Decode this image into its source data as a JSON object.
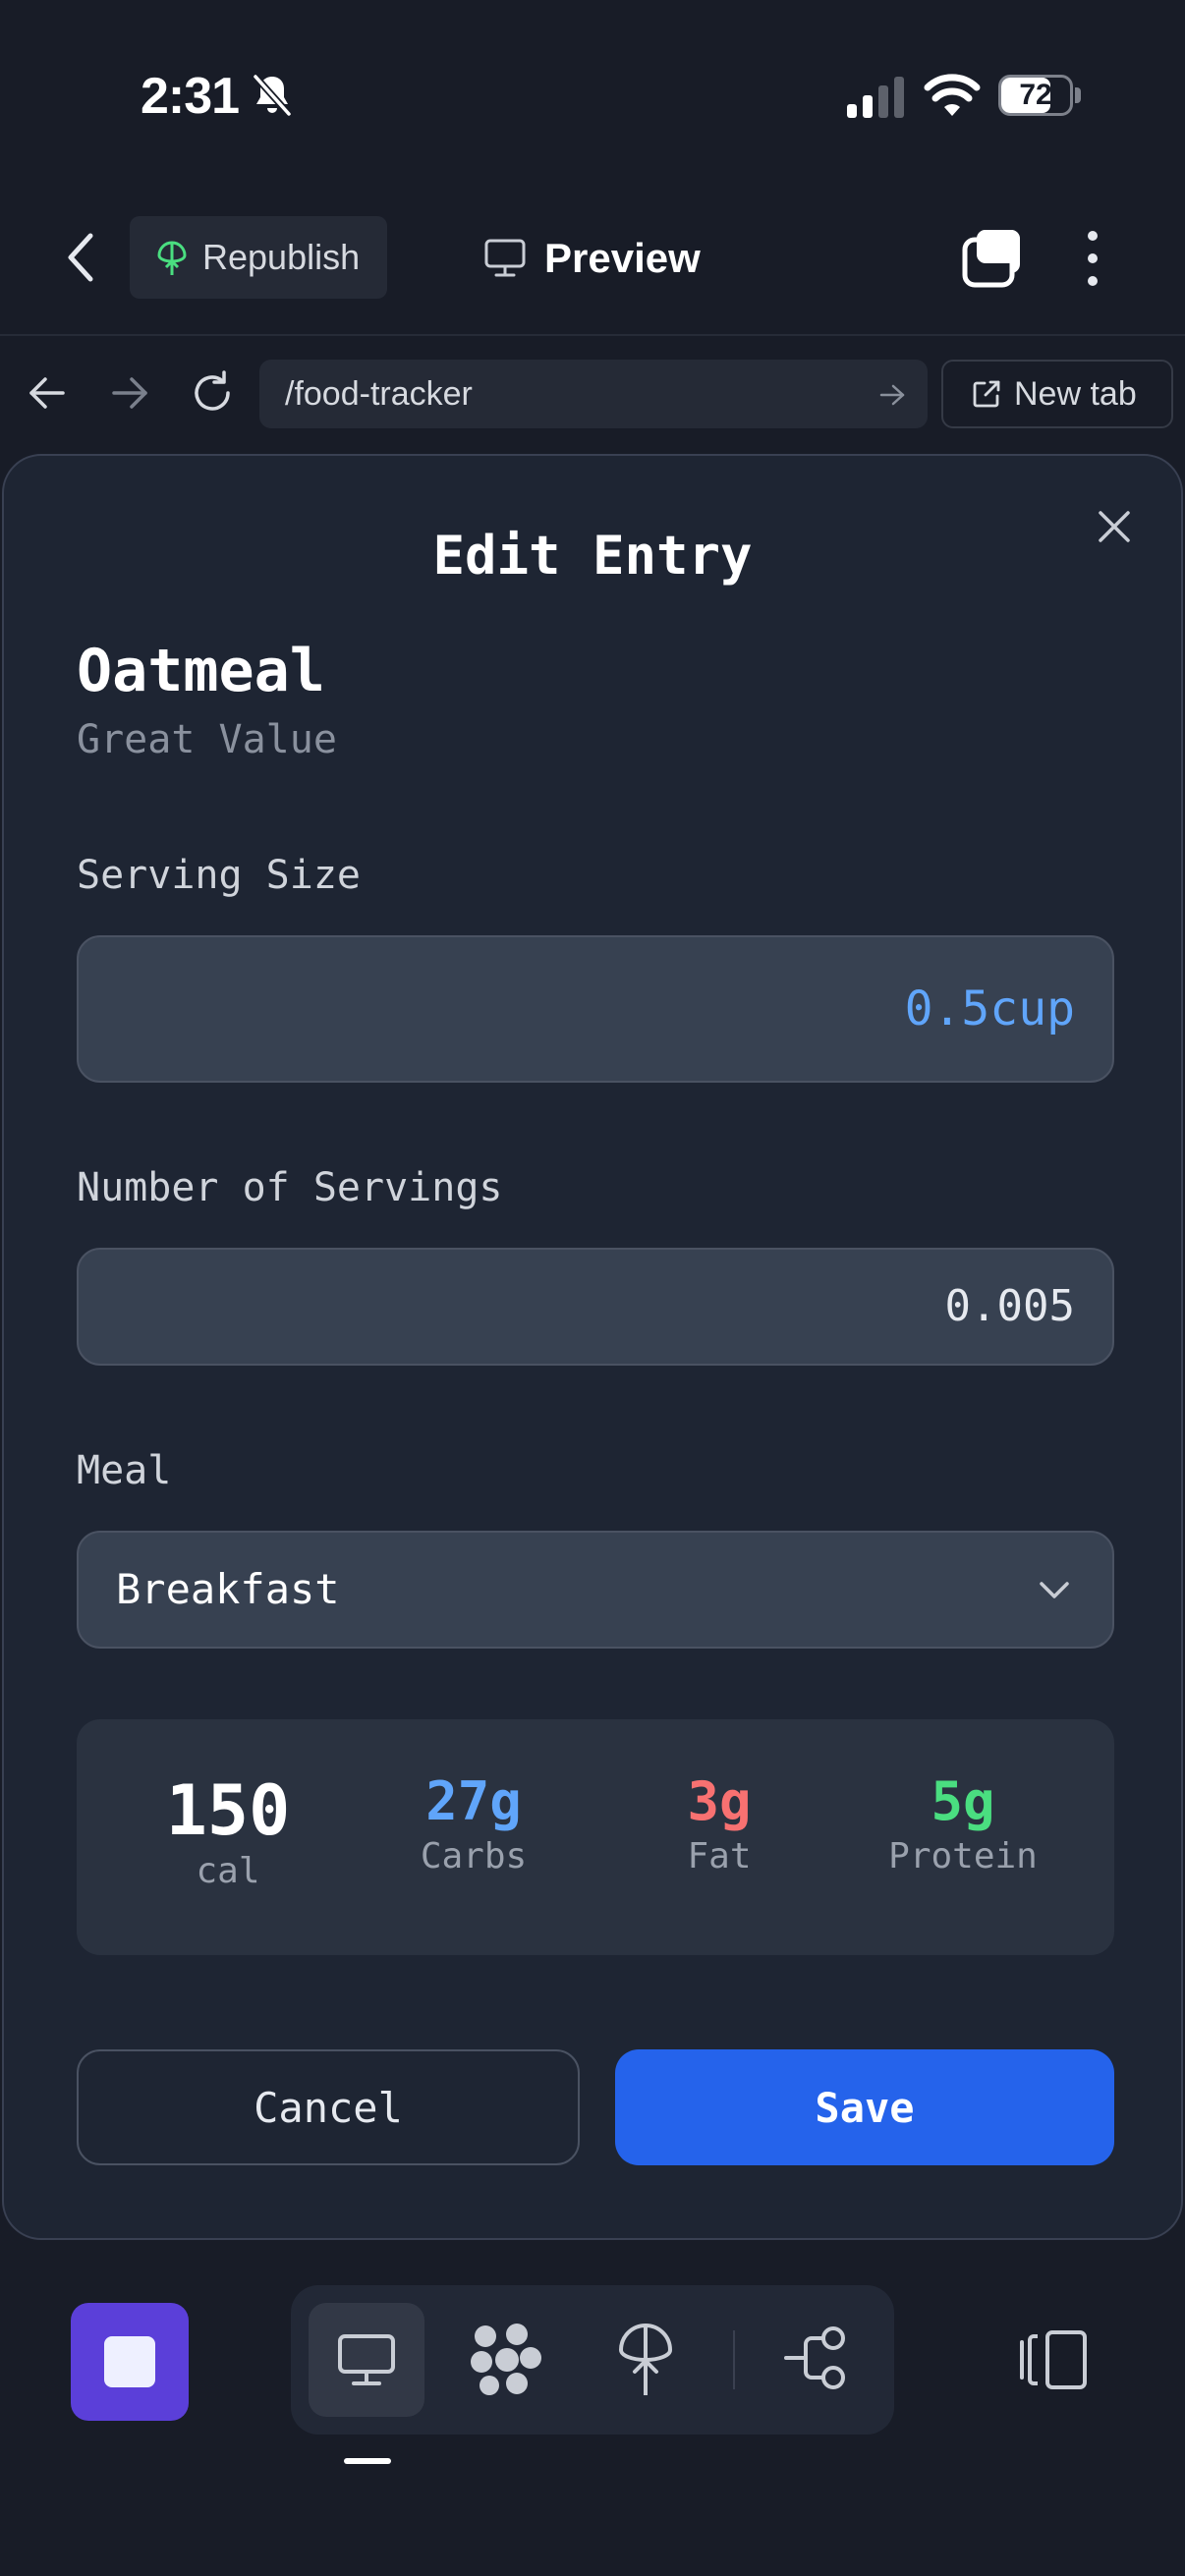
{
  "status_bar": {
    "time": "2:31",
    "battery": "72",
    "battery_level": 0.72
  },
  "toolbar": {
    "republish_label": "Republish",
    "preview_label": "Preview"
  },
  "browser": {
    "url": "/food-tracker",
    "new_tab_label": "New tab"
  },
  "modal": {
    "title": "Edit Entry",
    "food_name": "Oatmeal",
    "brand": "Great Value",
    "serving_size_label": "Serving Size",
    "serving_size_value": "0.5cup",
    "servings_label": "Number of Servings",
    "servings_value": "0.005",
    "meal_label": "Meal",
    "meal_value": "Breakfast",
    "nutrition": {
      "calories": "150",
      "calories_unit": "cal",
      "carbs": "27g",
      "carbs_label": "Carbs",
      "fat": "3g",
      "fat_label": "Fat",
      "protein": "5g",
      "protein_label": "Protein"
    },
    "cancel_label": "Cancel",
    "save_label": "Save"
  },
  "colors": {
    "accent": "#2563eb",
    "carbs": "#60a5fa",
    "fat": "#f87171",
    "protein": "#4ade80",
    "stop_button": "#5b3fd9"
  }
}
